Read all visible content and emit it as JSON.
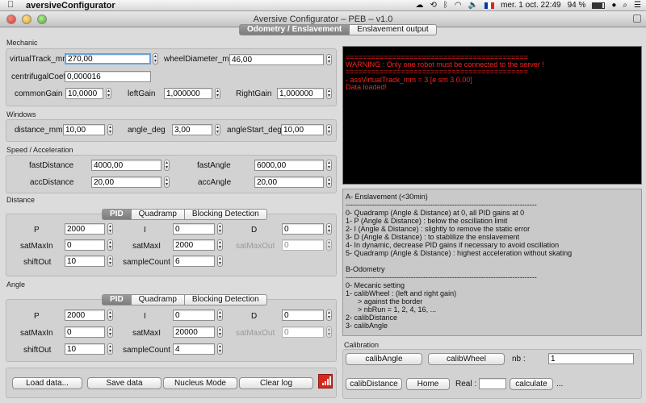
{
  "menubar": {
    "apple_icon": "apple-logo-icon",
    "app_name": "aversiveConfigurator",
    "battery": "94 %",
    "clock": "mer. 1 oct.  22:49"
  },
  "window": {
    "title": "Aversive Configurator – PEB – v1.0"
  },
  "top_tabs": [
    "Odometry / Enslavement",
    "Enslavement output"
  ],
  "mechanic": {
    "section": "Mechanic",
    "virtualTrack_label": "virtualTrack_mm",
    "virtualTrack_value": "270,00",
    "wheelDiameter_label": "wheelDiameter_mm",
    "wheelDiameter_value": "46,00",
    "centrifugal_label": "centrifugalCoef",
    "centrifugal_value": "0,000016",
    "commonGain_label": "commonGain",
    "commonGain_value": "10,0000",
    "leftGain_label": "leftGain",
    "leftGain_value": "1,000000",
    "rightGain_label": "RightGain",
    "rightGain_value": "1,000000"
  },
  "windows": {
    "section": "Windows",
    "distance_label": "distance_mm",
    "distance_value": "10,00",
    "angle_label": "angle_deg",
    "angle_value": "3,00",
    "angleStart_label": "angleStart_deg",
    "angleStart_value": "10,00"
  },
  "speed": {
    "section": "Speed / Acceleration",
    "fastDistance_label": "fastDistance",
    "fastDistance_value": "4000,00",
    "fastAngle_label": "fastAngle",
    "fastAngle_value": "6000,00",
    "accDistance_label": "accDistance",
    "accDistance_value": "20,00",
    "accAngle_label": "accAngle",
    "accAngle_value": "20,00"
  },
  "distance": {
    "section": "Distance",
    "tabs": [
      "PID",
      "Quadramp",
      "Blocking Detection"
    ],
    "P_label": "P",
    "P_value": "2000",
    "I_label": "I",
    "I_value": "0",
    "D_label": "D",
    "D_value": "0",
    "satMaxIn_label": "satMaxIn",
    "satMaxIn_value": "0",
    "satMaxI_label": "satMaxI",
    "satMaxI_value": "2000",
    "satMaxOut_label": "satMaxOut",
    "satMaxOut_value": "0",
    "shiftOut_label": "shiftOut",
    "shiftOut_value": "10",
    "sampleCount_label": "sampleCount",
    "sampleCount_value": "6"
  },
  "angle": {
    "section": "Angle",
    "tabs": [
      "PID",
      "Quadramp",
      "Blocking Detection"
    ],
    "P_label": "P",
    "P_value": "2000",
    "I_label": "I",
    "I_value": "0",
    "D_label": "D",
    "D_value": "0",
    "satMaxIn_label": "satMaxIn",
    "satMaxIn_value": "0",
    "satMaxI_label": "satMaxI",
    "satMaxI_value": "20000",
    "satMaxOut_label": "satMaxOut",
    "satMaxOut_value": "0",
    "shiftOut_label": "shiftOut",
    "shiftOut_value": "10",
    "sampleCount_label": "sampleCount",
    "sampleCount_value": "4"
  },
  "bottom_buttons": {
    "load": "Load data...",
    "save": "Save data",
    "nucleus": "Nucleus Mode",
    "clear": "Clear log"
  },
  "console": {
    "lines": [
      "===========================================",
      "WARNING : Only one robot must be connected to the server !",
      "===========================================",
      "- assVirtualTrack_mm = 3 [e sm 3 0.00]",
      "Data loaded!"
    ],
    "text_color": "#ff2020"
  },
  "help": {
    "lines": [
      "A- Enslavement (<30min)",
      "-------------------------------------------------------------------------------",
      "0- Quadramp (Angle & Distance) at 0, all PID gains at 0",
      "1- P (Angle & Distance) : below the oscillation limit",
      "2- I (Angle & Distance) : slightly to remove the static error",
      "3- D (Angle & Distance) : to stablilize the enslavement",
      "4- In dynamic, decrease PID gains if necessary to avoid oscillation",
      "5- Quadramp (Angle & Distance) : highest acceleration without skating",
      "",
      "B-Odometry",
      "-------------------------------------------------------------------------------",
      "0- Mecanic setting",
      "1- calibWheel : (left and right gain)",
      "      > against the border",
      "      > nbRun = 1, 2, 4, 16, ...",
      "2- calibDistance",
      "3- calibAngle"
    ]
  },
  "calibration": {
    "section": "Calibration",
    "calibAngle": "calibAngle",
    "calibWheel": "calibWheel",
    "nb_label": "nb :",
    "nb_value": "1",
    "calibDistance": "calibDistance",
    "home": "Home",
    "real_label": "Real :",
    "real_value": "",
    "calculate": "calculate",
    "ellipsis": "..."
  }
}
